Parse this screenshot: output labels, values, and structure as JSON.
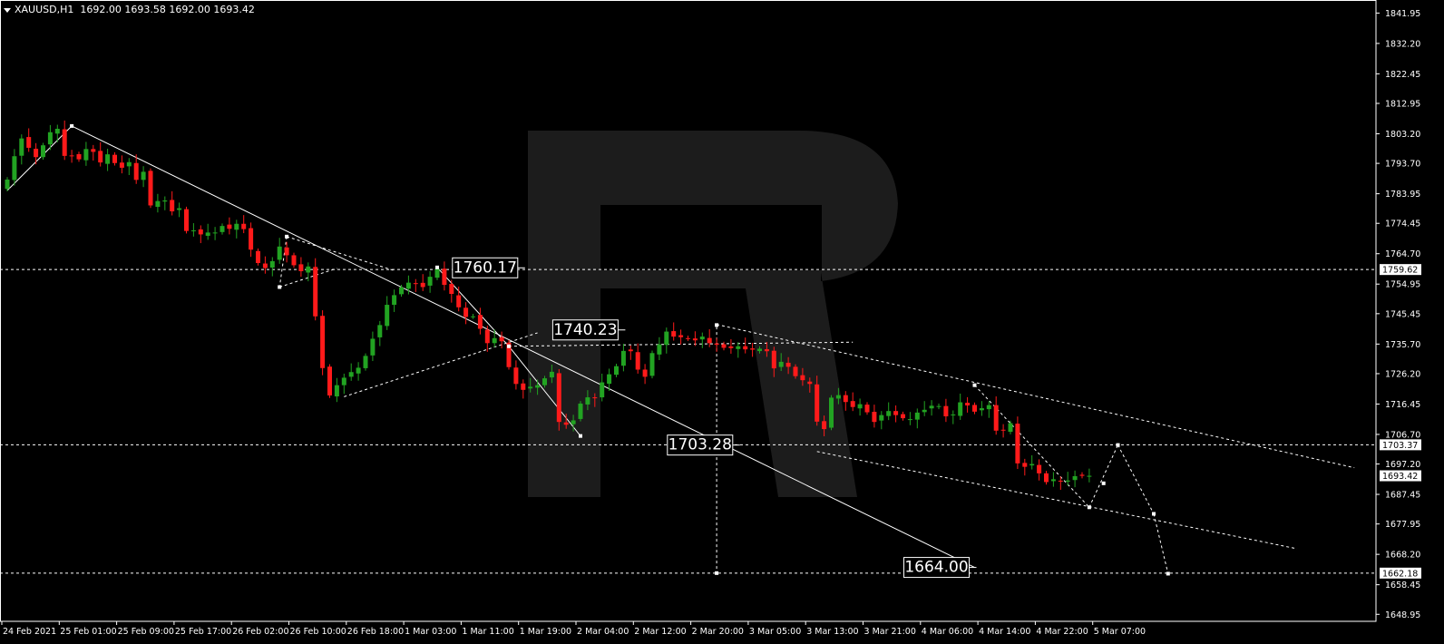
{
  "header": {
    "symbol": "XAUUSD,H1",
    "ohlc": "1692.00 1693.58 1692.00 1693.42"
  },
  "colors": {
    "background": "#000000",
    "bull": "#22a322",
    "bear": "#ff1a1a",
    "grid": "#ffffff",
    "axis_text": "#ffffff",
    "watermark": "#1c1c1c"
  },
  "chart_data": {
    "type": "candlestick",
    "title": "",
    "ylim": [
      1646.7,
      1846.14
    ],
    "y_ticks": [
      "1841.95",
      "1832.20",
      "1822.45",
      "1812.95",
      "1803.20",
      "1793.70",
      "1783.95",
      "1774.45",
      "1764.70",
      "1754.95",
      "1745.45",
      "1735.70",
      "1726.20",
      "1716.45",
      "1706.70",
      "1697.20",
      "1687.45",
      "1677.95",
      "1668.20",
      "1658.45",
      "1648.95"
    ],
    "x_ticks": [
      "24 Feb 2021",
      "25 Feb 01:00",
      "25 Feb 09:00",
      "25 Feb 17:00",
      "26 Feb 02:00",
      "26 Feb 10:00",
      "26 Feb 18:00",
      "1 Mar 03:00",
      "1 Mar 11:00",
      "1 Mar 19:00",
      "2 Mar 04:00",
      "2 Mar 12:00",
      "2 Mar 20:00",
      "3 Mar 05:00",
      "3 Mar 13:00",
      "3 Mar 21:00",
      "4 Mar 06:00",
      "4 Mar 14:00",
      "4 Mar 22:00",
      "5 Mar 07:00"
    ],
    "price_tags": [
      {
        "label": "1759.62",
        "price": 1759.62
      },
      {
        "label": "1703.37",
        "price": 1703.37
      },
      {
        "label": "1693.42",
        "price": 1693.42
      },
      {
        "label": "1662.18",
        "price": 1662.18
      }
    ],
    "level_labels": [
      {
        "text": "1760.17",
        "price": 1760.17,
        "bar": 72
      },
      {
        "text": "1740.23",
        "price": 1740.23,
        "bar": 86
      },
      {
        "text": "1703.28",
        "price": 1703.28,
        "bar": 102
      },
      {
        "text": "1664.00",
        "price": 1664.0,
        "bar": 135
      }
    ],
    "horizontal_levels": [
      1759.62,
      1703.37,
      1662.18
    ],
    "closes": [
      1788.5,
      1796.0,
      1801.7,
      1798.7,
      1795.7,
      1799.5,
      1803.7,
      1804.8,
      1796.1,
      1796.2,
      1795.0,
      1798.3,
      1797.4,
      1794.0,
      1796.6,
      1793.8,
      1792.3,
      1794.1,
      1788.4,
      1791.0,
      1780.2,
      1781.6,
      1781.8,
      1778.3,
      1779.3,
      1772.0,
      1772.2,
      1770.9,
      1771.5,
      1771.5,
      1773.6,
      1772.7,
      1774.3,
      1772.6,
      1766.0,
      1761.7,
      1760.1,
      1762.3,
      1767.0,
      1764.2,
      1761.0,
      1759.1,
      1760.6,
      1744.6,
      1728.0,
      1719.2,
      1722.5,
      1724.9,
      1726.7,
      1728.1,
      1731.9,
      1737.4,
      1741.8,
      1748.3,
      1751.4,
      1753.9,
      1755.4,
      1755.2,
      1754.0,
      1757.3,
      1759.9,
      1754.7,
      1751.8,
      1747.5,
      1744.4,
      1744.6,
      1740.6,
      1736.0,
      1737.6,
      1736.6,
      1728.3,
      1722.9,
      1721.0,
      1722.0,
      1722.5,
      1724.7,
      1726.8,
      1710.7,
      1709.8,
      1711.2,
      1716.6,
      1718.6,
      1718.3,
      1723.4,
      1726.0,
      1728.6,
      1733.5,
      1733.4,
      1727.5,
      1725.2,
      1732.8,
      1735.6,
      1739.7,
      1738.1,
      1737.9,
      1737.5,
      1736.9,
      1738.1,
      1736.0,
      1735.5,
      1734.5,
      1734.4,
      1735.0,
      1734.0,
      1733.9,
      1734.2,
      1733.4,
      1727.9,
      1730.0,
      1728.4,
      1725.4,
      1724.1,
      1722.9,
      1710.8,
      1708.4,
      1718.5,
      1719.3,
      1717.1,
      1715.5,
      1716.4,
      1713.8,
      1710.7,
      1712.9,
      1714.2,
      1712.9,
      1711.9,
      1711.6,
      1713.7,
      1714.6,
      1715.9,
      1715.8,
      1712.5,
      1713.1,
      1717.0,
      1716.0,
      1714.0,
      1715.1,
      1716.1,
      1707.9,
      1708.0,
      1710.3,
      1697.4,
      1696.3,
      1697.2,
      1694.2,
      1691.4,
      1692.3,
      1691.7,
      1691.9,
      1693.3,
      1693.4,
      1693.42
    ],
    "trend_lines": [
      {
        "style": "solid",
        "points": [
          [
            9,
            1805.7
          ],
          [
            135,
            1664.0
          ]
        ]
      },
      {
        "style": "solid",
        "points": [
          [
            0,
            1785.0
          ],
          [
            9,
            1805.7
          ]
        ]
      },
      {
        "style": "dashed",
        "points": [
          [
            39,
            1770.2
          ],
          [
            54,
            1759.3
          ]
        ]
      },
      {
        "style": "dashed",
        "points": [
          [
            39,
            1770.2
          ],
          [
            38,
            1754.0
          ]
        ]
      },
      {
        "style": "dashed",
        "points": [
          [
            38,
            1754.0
          ],
          [
            46,
            1760.0
          ]
        ]
      },
      {
        "style": "dashed",
        "points": [
          [
            47,
            1718.8
          ],
          [
            74,
            1739.3
          ]
        ]
      },
      {
        "style": "solid",
        "points": [
          [
            60,
            1760.3
          ],
          [
            70,
            1735.0
          ]
        ]
      },
      {
        "style": "solid",
        "points": [
          [
            70,
            1735.0
          ],
          [
            80,
            1706.2
          ]
        ]
      },
      {
        "style": "dashed",
        "points": [
          [
            70,
            1735.0
          ],
          [
            118,
            1736.3
          ]
        ]
      },
      {
        "style": "dashed",
        "points": [
          [
            99,
            1742.0
          ],
          [
            188,
            1696.0
          ]
        ]
      },
      {
        "style": "dashed",
        "points": [
          [
            113,
            1701.2
          ],
          [
            180,
            1670.0
          ]
        ]
      },
      {
        "style": "dashed",
        "points": [
          [
            99,
            1741.3
          ],
          [
            99,
            1662.18
          ]
        ]
      },
      {
        "style": "dashed",
        "points": [
          [
            135,
            1722.5
          ],
          [
            151,
            1683.3
          ]
        ]
      },
      {
        "style": "dashed",
        "points": [
          [
            151,
            1683.3
          ],
          [
            155,
            1703.3
          ]
        ]
      },
      {
        "style": "dashed",
        "points": [
          [
            155,
            1703.3
          ],
          [
            160,
            1681.2
          ]
        ]
      },
      {
        "style": "dashed",
        "points": [
          [
            160,
            1681.2
          ],
          [
            162,
            1662.0
          ]
        ]
      }
    ],
    "markers": [
      [
        9,
        1805.7
      ],
      [
        39,
        1770.2
      ],
      [
        38,
        1754.0
      ],
      [
        60,
        1760.3
      ],
      [
        70,
        1735.0
      ],
      [
        80,
        1706.2
      ],
      [
        99,
        1741.8
      ],
      [
        99,
        1701.0
      ],
      [
        99,
        1662.18
      ],
      [
        133,
        1662.18
      ],
      [
        135,
        1722.5
      ],
      [
        151,
        1683.3
      ],
      [
        153,
        1691.0
      ],
      [
        155,
        1703.3
      ],
      [
        160,
        1681.2
      ],
      [
        162,
        1662.0
      ]
    ]
  }
}
